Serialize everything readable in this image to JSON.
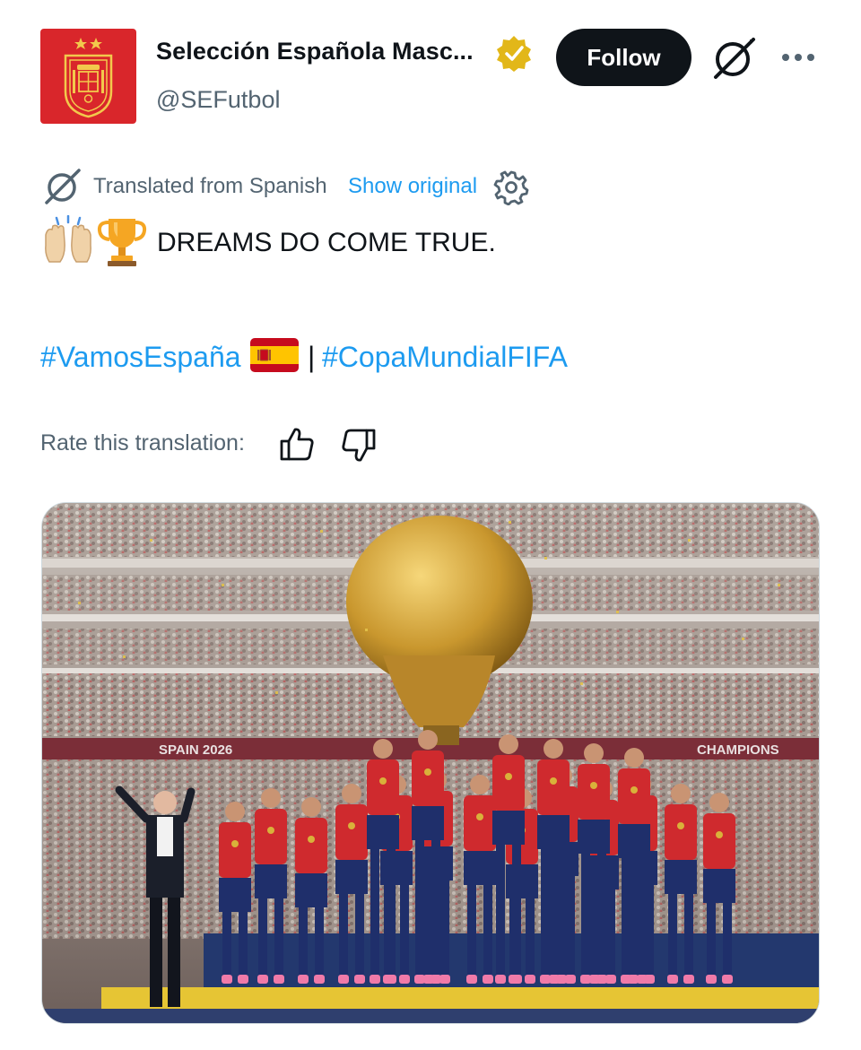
{
  "author": {
    "display_name": "Selección Española Masc...",
    "handle": "@SEFutbol",
    "verified": true,
    "verified_badge_color": "#e2b719",
    "avatar_color": "#d9262b"
  },
  "header": {
    "follow_label": "Follow",
    "grok_icon": "grok-icon",
    "more_icon": "more-icon"
  },
  "translation": {
    "notice": "Translated from Spanish",
    "show_original": "Show original",
    "settings_icon": "gear-icon"
  },
  "tweet": {
    "emojis": [
      "raising-hands-emoji",
      "trophy-emoji"
    ],
    "text": "DREAMS DO COME TRUE.",
    "hashtag1": "#VamosEspaña",
    "flag": "spain-flag-emoji",
    "separator": "|",
    "hashtag2": "#CopaMundialFIFA"
  },
  "rating": {
    "label": "Rate this translation:",
    "up_icon": "thumbs-up-icon",
    "down_icon": "thumbs-down-icon"
  },
  "media": {
    "kind": "photo",
    "banner_left": "SPAIN 2026",
    "banner_right": "CHAMPIONS"
  },
  "colors": {
    "link": "#1d9bf0",
    "secondary_text": "#536471",
    "primary_text": "#0f1419",
    "button_bg": "#0f1419"
  }
}
